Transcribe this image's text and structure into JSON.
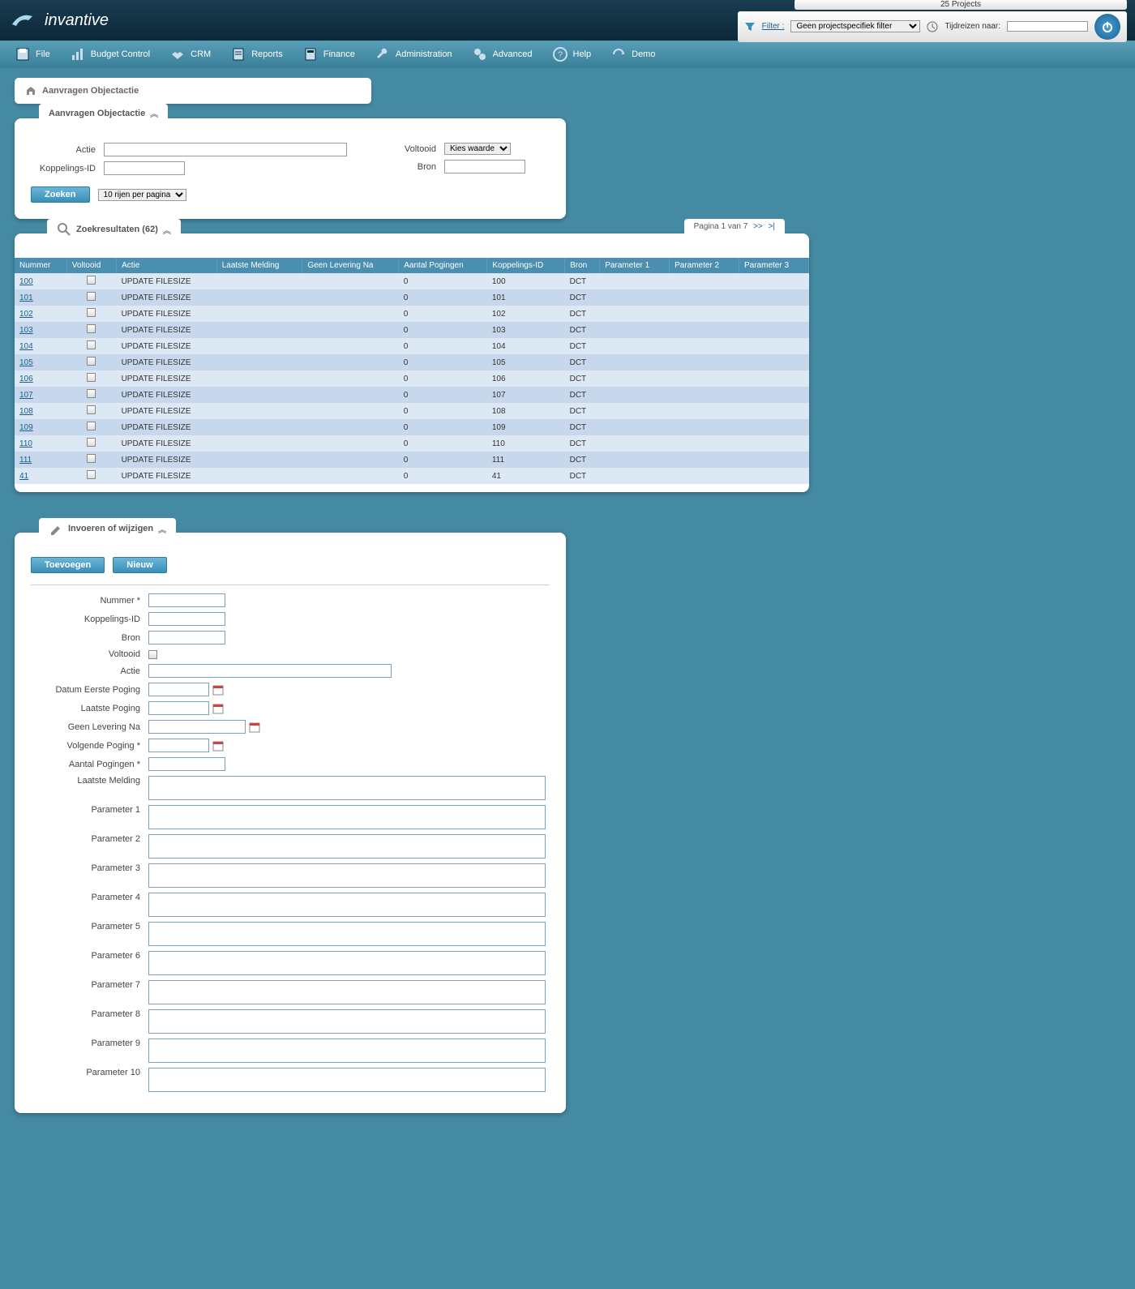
{
  "header": {
    "logo_text": "invantive",
    "projects_count": "25 Projects",
    "filter_label": "Filter :",
    "filter_value": "Geen projectspecifiek filter",
    "tijdreizen_label": "Tijdreizen naar:"
  },
  "menu": [
    {
      "label": "File",
      "icon": "disk"
    },
    {
      "label": "Budget Control",
      "icon": "chart"
    },
    {
      "label": "CRM",
      "icon": "handshake"
    },
    {
      "label": "Reports",
      "icon": "report"
    },
    {
      "label": "Finance",
      "icon": "calc"
    },
    {
      "label": "Administration",
      "icon": "wrench"
    },
    {
      "label": "Advanced",
      "icon": "gears"
    },
    {
      "label": "Help",
      "icon": "help"
    },
    {
      "label": "Demo",
      "icon": "demo"
    }
  ],
  "breadcrumb": "Aanvragen Objectactie",
  "search_panel": {
    "title": "Aanvragen Objectactie",
    "labels": {
      "actie": "Actie",
      "koppelings_id": "Koppelings-ID",
      "voltooid": "Voltooid",
      "bron": "Bron"
    },
    "voltooid_value": "Kies waarde",
    "zoeken_btn": "Zoeken",
    "rows_per_page": "10 rijen per pagina"
  },
  "results_panel": {
    "title": "Zoekresultaten (62)",
    "pagination": "Pagina 1 van 7",
    "pag_next": ">>",
    "pag_last": ">|",
    "columns": [
      "Nummer",
      "Voltooid",
      "Actie",
      "Laatste Melding",
      "Geen Levering Na",
      "Aantal Pogingen",
      "Koppelings-ID",
      "Bron",
      "Parameter 1",
      "Parameter 2",
      "Parameter 3"
    ],
    "rows": [
      {
        "nummer": "100",
        "actie": "UPDATE FILESIZE",
        "pogingen": "0",
        "koppel": "100",
        "bron": "DCT"
      },
      {
        "nummer": "101",
        "actie": "UPDATE FILESIZE",
        "pogingen": "0",
        "koppel": "101",
        "bron": "DCT"
      },
      {
        "nummer": "102",
        "actie": "UPDATE FILESIZE",
        "pogingen": "0",
        "koppel": "102",
        "bron": "DCT"
      },
      {
        "nummer": "103",
        "actie": "UPDATE FILESIZE",
        "pogingen": "0",
        "koppel": "103",
        "bron": "DCT"
      },
      {
        "nummer": "104",
        "actie": "UPDATE FILESIZE",
        "pogingen": "0",
        "koppel": "104",
        "bron": "DCT"
      },
      {
        "nummer": "105",
        "actie": "UPDATE FILESIZE",
        "pogingen": "0",
        "koppel": "105",
        "bron": "DCT"
      },
      {
        "nummer": "106",
        "actie": "UPDATE FILESIZE",
        "pogingen": "0",
        "koppel": "106",
        "bron": "DCT"
      },
      {
        "nummer": "107",
        "actie": "UPDATE FILESIZE",
        "pogingen": "0",
        "koppel": "107",
        "bron": "DCT"
      },
      {
        "nummer": "108",
        "actie": "UPDATE FILESIZE",
        "pogingen": "0",
        "koppel": "108",
        "bron": "DCT"
      },
      {
        "nummer": "109",
        "actie": "UPDATE FILESIZE",
        "pogingen": "0",
        "koppel": "109",
        "bron": "DCT"
      },
      {
        "nummer": "110",
        "actie": "UPDATE FILESIZE",
        "pogingen": "0",
        "koppel": "110",
        "bron": "DCT"
      },
      {
        "nummer": "111",
        "actie": "UPDATE FILESIZE",
        "pogingen": "0",
        "koppel": "111",
        "bron": "DCT"
      },
      {
        "nummer": "41",
        "actie": "UPDATE FILESIZE",
        "pogingen": "0",
        "koppel": "41",
        "bron": "DCT"
      }
    ]
  },
  "edit_panel": {
    "title": "Invoeren of wijzigen",
    "toevoegen_btn": "Toevoegen",
    "nieuw_btn": "Nieuw",
    "labels": {
      "nummer": "Nummer *",
      "koppelings_id": "Koppelings-ID",
      "bron": "Bron",
      "voltooid": "Voltooid",
      "actie": "Actie",
      "datum_eerste": "Datum Eerste Poging",
      "laatste_poging": "Laatste Poging",
      "geen_levering": "Geen Levering Na",
      "volgende_poging": "Volgende Poging *",
      "aantal_pogingen": "Aantal Pogingen *",
      "laatste_melding": "Laatste Melding",
      "p1": "Parameter 1",
      "p2": "Parameter 2",
      "p3": "Parameter 3",
      "p4": "Parameter 4",
      "p5": "Parameter 5",
      "p6": "Parameter 6",
      "p7": "Parameter 7",
      "p8": "Parameter 8",
      "p9": "Parameter 9",
      "p10": "Parameter 10"
    }
  }
}
